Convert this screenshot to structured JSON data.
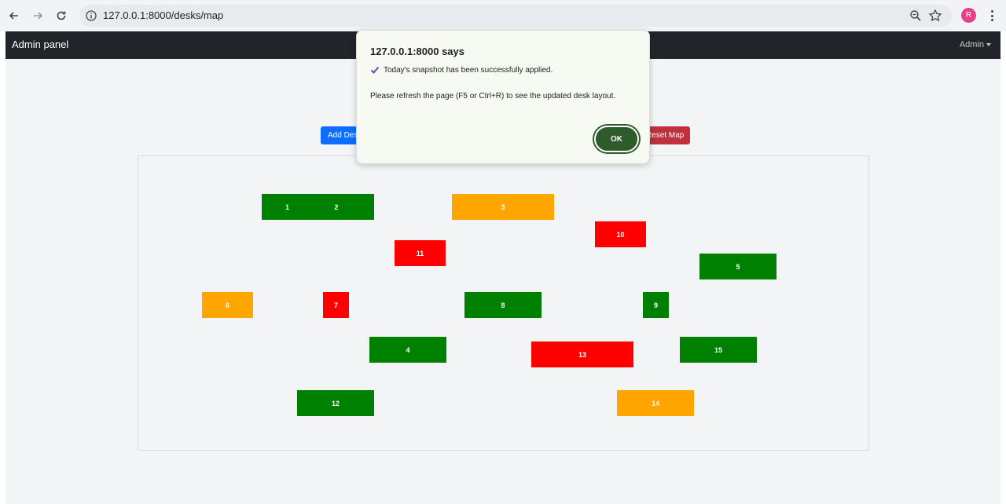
{
  "browser": {
    "url": "127.0.0.1:8000/desks/map",
    "profile_initial": "R"
  },
  "navbar": {
    "brand": "Admin panel",
    "admin_menu": "Admin"
  },
  "toolbar": {
    "add_desk_label": "Add Desk",
    "reset_map_label": "Reset Map"
  },
  "desks": [
    {
      "label": "1",
      "status": "green"
    },
    {
      "label": "2",
      "status": "green"
    },
    {
      "label": "3",
      "status": "orange"
    },
    {
      "label": "10",
      "status": "red"
    },
    {
      "label": "11",
      "status": "red"
    },
    {
      "label": "5",
      "status": "green"
    },
    {
      "label": "6",
      "status": "orange"
    },
    {
      "label": "7",
      "status": "red"
    },
    {
      "label": "8",
      "status": "green"
    },
    {
      "label": "9",
      "status": "green"
    },
    {
      "label": "4",
      "status": "green"
    },
    {
      "label": "13",
      "status": "red"
    },
    {
      "label": "15",
      "status": "green"
    },
    {
      "label": "12",
      "status": "green"
    },
    {
      "label": "14",
      "status": "orange"
    }
  ],
  "status_colors": {
    "green": "#008000",
    "orange": "#ffa500",
    "red": "#ff0000"
  },
  "dialog": {
    "title": "127.0.0.1:8000 says",
    "message_line1": "Today's snapshot has been successfully applied.",
    "message_line2": "Please refresh the page (F5 or Ctrl+R) to see the updated desk layout.",
    "ok_label": "OK"
  }
}
